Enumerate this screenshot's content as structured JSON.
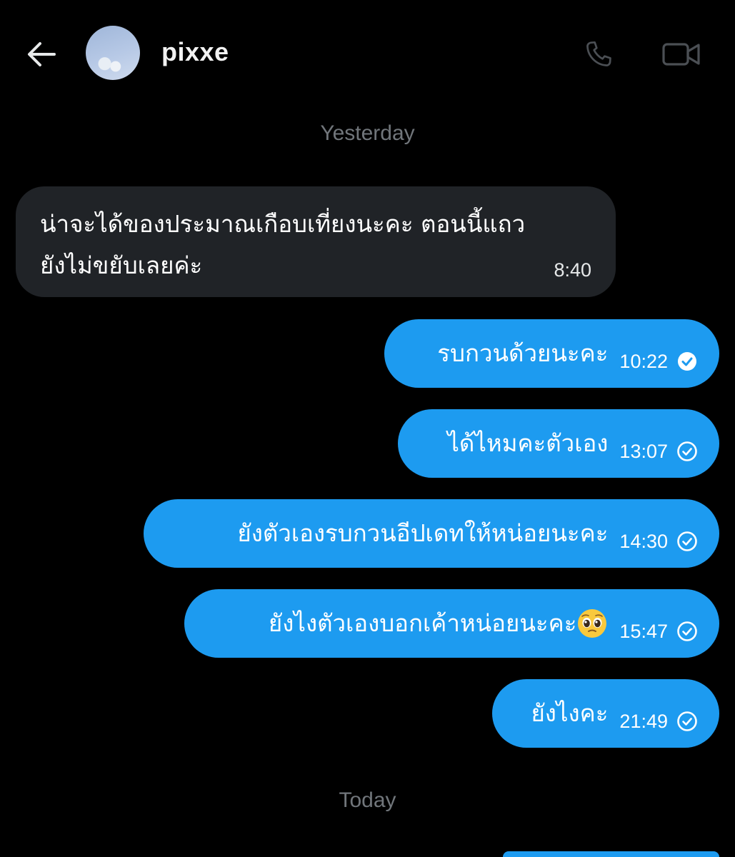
{
  "header": {
    "contact_name": "pixxe"
  },
  "separators": {
    "yesterday": "Yesterday",
    "today": "Today"
  },
  "messages": [
    {
      "direction": "incoming",
      "line1": "น่าจะได้ของประมาณเกือบเที่ยงนะคะ ตอนนี้แถว",
      "line2": "ยังไม่ขยับเลยค่ะ",
      "time": "8:40"
    },
    {
      "direction": "outgoing",
      "text": "รบกวนด้วยนะคะ",
      "time": "10:22",
      "status": "read"
    },
    {
      "direction": "outgoing",
      "text": "ได้ไหมคะตัวเอง",
      "time": "13:07",
      "status": "sent"
    },
    {
      "direction": "outgoing",
      "text": "ยังตัวเองรบกวนอีปเดทให้หน่อยนะคะ",
      "time": "14:30",
      "status": "sent"
    },
    {
      "direction": "outgoing",
      "text": "ยังไงตัวเองบอกเค้าหน่อยนะคะ",
      "emoji": "pleading-face",
      "time": "15:47",
      "status": "sent"
    },
    {
      "direction": "outgoing",
      "text": "ยังไงคะ",
      "time": "21:49",
      "status": "sent"
    }
  ],
  "icons": {
    "back": "arrow-left-icon",
    "call": "phone-icon",
    "video": "video-camera-icon"
  },
  "colors": {
    "background": "#000000",
    "outgoing_bubble": "#1d9bf0",
    "incoming_bubble": "#202327",
    "muted_text": "#71767b"
  }
}
